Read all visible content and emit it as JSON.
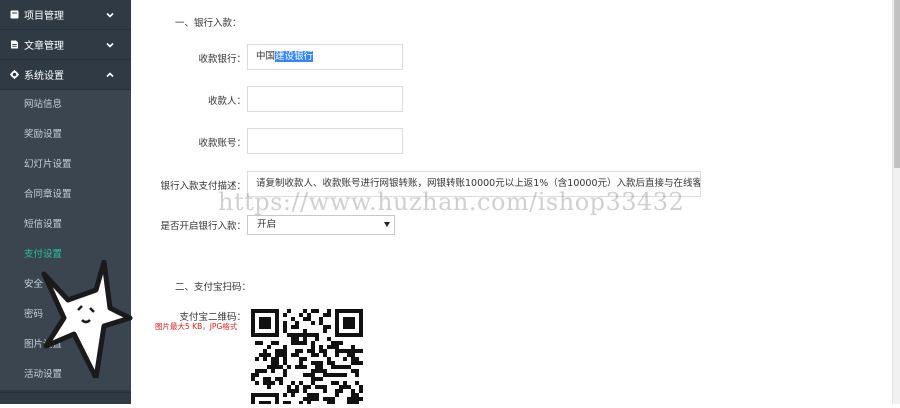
{
  "sidebar": {
    "groups": [
      {
        "label": "项目管理",
        "icon": "book-icon",
        "expanded": false
      },
      {
        "label": "文章管理",
        "icon": "file-icon",
        "expanded": false
      },
      {
        "label": "系统设置",
        "icon": "gear-icon",
        "expanded": true
      }
    ],
    "items": [
      {
        "label": "网站信息",
        "active": false
      },
      {
        "label": "奖励设置",
        "active": false
      },
      {
        "label": "幻灯片设置",
        "active": false
      },
      {
        "label": "合同章设置",
        "active": false
      },
      {
        "label": "短信设置",
        "active": false
      },
      {
        "label": "支付设置",
        "active": true
      },
      {
        "label": "安全",
        "active": false
      },
      {
        "label": "密码",
        "active": false
      },
      {
        "label": "图片设置",
        "active": false
      },
      {
        "label": "活动设置",
        "active": false
      }
    ],
    "active_color": "#25c3a3"
  },
  "bank_section": {
    "title": "一、银行入款：",
    "bank_label": "收款银行：",
    "bank_value_plain": "中国",
    "bank_value_selected": "建设银行",
    "payee_label": "收款人：",
    "payee_value": "",
    "account_label": "收款账号：",
    "account_value": "",
    "desc_label": "银行入款支付描述：",
    "desc_value": "请复制收款人、收款账号进行网银转账，网银转账10000元以上返1%（含10000元）入款后直接与在线客服",
    "enable_label": "是否开启银行入款：",
    "enable_value": "开启"
  },
  "alipay_section": {
    "title": "二、支付宝扫码：",
    "qr_label": "支付宝二维码：",
    "qr_hint": "图片最大5 KB，JPG格式"
  },
  "watermark": "https://www.huzhan.com/ishop33432"
}
